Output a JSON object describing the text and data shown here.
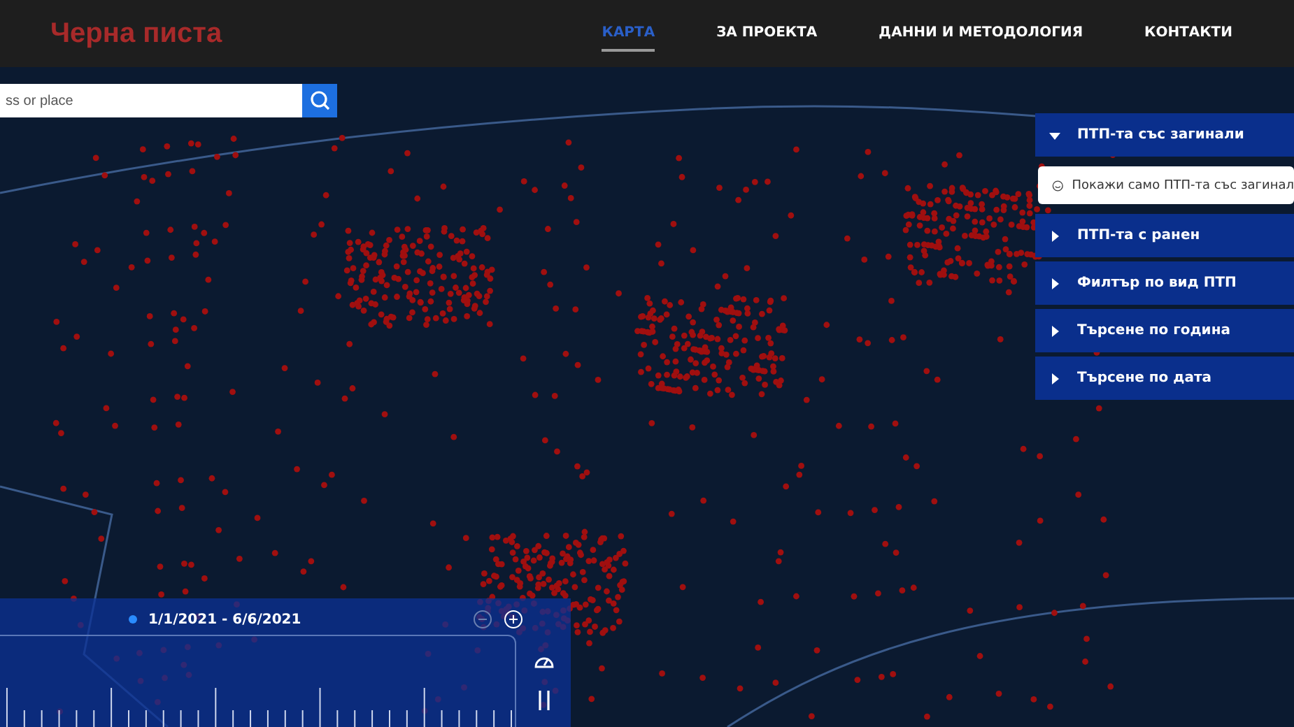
{
  "logo": "Черна писта",
  "nav": [
    {
      "label": "КАРТА",
      "selected": true
    },
    {
      "label": "ЗА ПРОЕКТА",
      "selected": false
    },
    {
      "label": "ДАННИ И МЕТОДОЛОГИЯ",
      "selected": false
    },
    {
      "label": "КОНТАКТИ",
      "selected": false
    }
  ],
  "search": {
    "placeholder": "ss or place"
  },
  "filters": [
    {
      "label": "ПТП-та със загинали",
      "expanded": true,
      "option": "Покажи само ПТП-та със загинал"
    },
    {
      "label": "ПТП-та с ранен",
      "expanded": false
    },
    {
      "label": "Филтър по вид ПТП",
      "expanded": false
    },
    {
      "label": "Търсене по година",
      "expanded": false
    },
    {
      "label": "Търсене по дата",
      "expanded": false
    }
  ],
  "timeline": {
    "range": "1/1/2021 - 6/6/2021"
  }
}
